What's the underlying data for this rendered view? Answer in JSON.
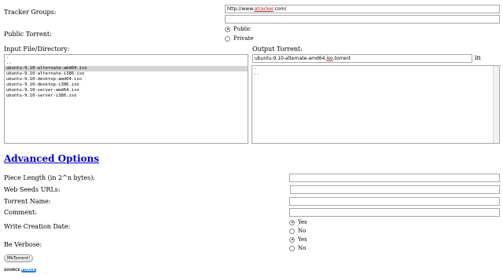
{
  "tracker": {
    "label": "Tracker Groups:",
    "url_prefix": "http://www.",
    "url_domain": "atracker",
    "url_suffix": ".com/",
    "second_value": ""
  },
  "public_torrent": {
    "label": "Public Torrent:",
    "options": [
      {
        "label": "Public",
        "selected": true
      },
      {
        "label": "Private",
        "selected": false
      }
    ]
  },
  "input": {
    "label": "Input File/Directory:",
    "items": [
      ".",
      "..",
      "ubuntu-9.10-alternate-amd64.iso",
      "ubuntu-9.10-alternate-i386.iso",
      "ubuntu-9.10-desktop-amd64.iso",
      "ubuntu-9.10-desktop-i386.iso",
      "ubuntu-9.10-server-amd64.iso",
      "ubuntu-9.10-server-i386.iso"
    ],
    "selected_index": 2
  },
  "output": {
    "label": "Output Torrent:",
    "value_before": "ubuntu-9.10-alternate-amd64.",
    "value_ul": "iso",
    "value_after": ".torrent",
    "in_label": "in",
    "items": [
      ".",
      ".."
    ]
  },
  "advanced": {
    "heading": "Advanced Options",
    "piece_length": {
      "label": "Piece Length (in 2^n bytes):",
      "value": ""
    },
    "web_seeds": {
      "label": "Web Seeds URLs:",
      "value": ""
    },
    "torrent_name": {
      "label": "Torrent Name:",
      "value": ""
    },
    "comment": {
      "label": "Comment:",
      "value": ""
    },
    "write_creation_date": {
      "label": "Write Creation Date:",
      "options": [
        {
          "label": "Yes",
          "selected": true
        },
        {
          "label": "No",
          "selected": false
        }
      ]
    },
    "be_verbose": {
      "label": "Be Verbose:",
      "options": [
        {
          "label": "Yes",
          "selected": true
        },
        {
          "label": "No",
          "selected": false
        }
      ]
    }
  },
  "submit": {
    "label": "MkTorrent!"
  },
  "footer_logo": {
    "part1": "SOURCE",
    "part2": "FORGE"
  }
}
